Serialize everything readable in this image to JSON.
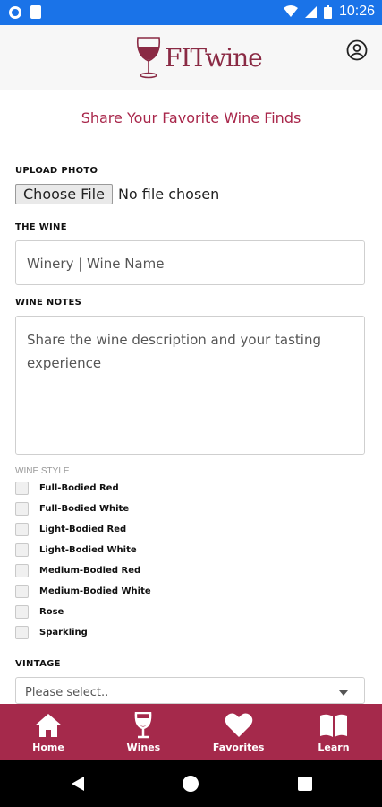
{
  "status_bar": {
    "time": "10:26"
  },
  "header": {
    "logo_text": "FITwine"
  },
  "page_title": "Share Your Favorite Wine Finds",
  "upload": {
    "label": "UPLOAD PHOTO",
    "button_label": "Choose File",
    "status": "No file chosen"
  },
  "wine": {
    "label": "THE WINE",
    "placeholder": "Winery | Wine Name"
  },
  "notes": {
    "label": "WINE NOTES",
    "placeholder": "Share the wine description and your tasting experience"
  },
  "wine_style": {
    "label": "WINE STYLE",
    "options": [
      "Full-Bodied Red",
      "Full-Bodied White",
      "Light-Bodied Red",
      "Light-Bodied White",
      "Medium-Bodied Red",
      "Medium-Bodied White",
      "Rose",
      "Sparkling"
    ]
  },
  "vintage": {
    "label": "VINTAGE",
    "selected": "Please select.."
  },
  "tabs": [
    {
      "label": "Home",
      "icon": "home-icon"
    },
    {
      "label": "Wines",
      "icon": "wine-glass-icon"
    },
    {
      "label": "Favorites",
      "icon": "heart-icon"
    },
    {
      "label": "Learn",
      "icon": "book-icon"
    }
  ],
  "colors": {
    "brand": "#a5294b",
    "status_bar": "#1a73e8",
    "title": "#a8264a"
  }
}
